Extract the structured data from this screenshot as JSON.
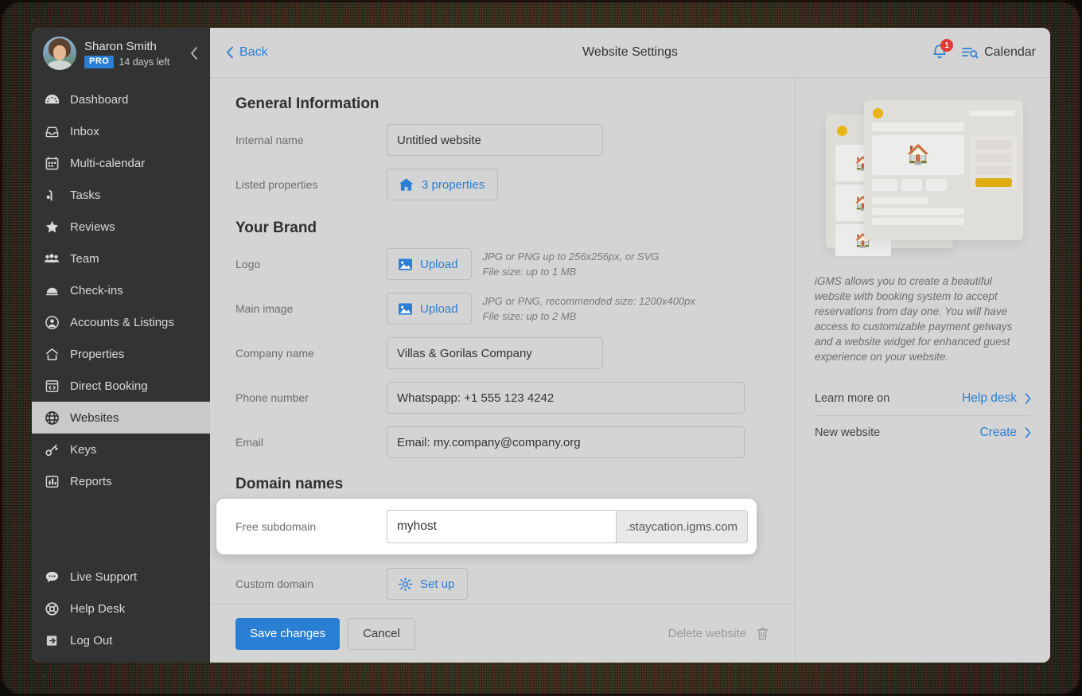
{
  "sidebar": {
    "user": {
      "name": "Sharon Smith",
      "plan_badge": "PRO",
      "trial": "14 days left"
    },
    "items": [
      {
        "label": "Dashboard",
        "icon": "dashboard-icon"
      },
      {
        "label": "Inbox",
        "icon": "inbox-icon"
      },
      {
        "label": "Multi-calendar",
        "icon": "calendar-icon"
      },
      {
        "label": "Tasks",
        "icon": "tasks-icon"
      },
      {
        "label": "Reviews",
        "icon": "star-icon"
      },
      {
        "label": "Team",
        "icon": "team-icon"
      },
      {
        "label": "Check-ins",
        "icon": "bell-service-icon"
      },
      {
        "label": "Accounts & Listings",
        "icon": "account-circle-icon"
      },
      {
        "label": "Properties",
        "icon": "home-icon"
      },
      {
        "label": "Direct Booking",
        "icon": "code-window-icon"
      },
      {
        "label": "Websites",
        "icon": "globe-icon",
        "active": true
      },
      {
        "label": "Keys",
        "icon": "key-icon"
      },
      {
        "label": "Reports",
        "icon": "bar-chart-icon"
      }
    ],
    "bottom_items": [
      {
        "label": "Live Support",
        "icon": "chat-bubble-icon"
      },
      {
        "label": "Help Desk",
        "icon": "lifebuoy-icon"
      },
      {
        "label": "Log Out",
        "icon": "logout-icon"
      }
    ]
  },
  "topbar": {
    "back_label": "Back",
    "title": "Website Settings",
    "notification_count": "1",
    "calendar_label": "Calendar"
  },
  "form": {
    "sections": {
      "general": "General Information",
      "brand": "Your Brand",
      "domains": "Domain names"
    },
    "internal_name": {
      "label": "Internal name",
      "value": "Untitled website"
    },
    "listed_properties": {
      "label": "Listed properties",
      "button": "3 properties"
    },
    "logo": {
      "label": "Logo",
      "button": "Upload",
      "hint_line1": "JPG or PNG up to 256x256px, or SVG",
      "hint_line2": "File size: up to 1 MB"
    },
    "main_image": {
      "label": "Main image",
      "button": "Upload",
      "hint_line1": "JPG or PNG, recommended size: 1200x400px",
      "hint_line2": "File size: up to 2 MB"
    },
    "company_name": {
      "label": "Company name",
      "value": "Villas & Gorilas Company"
    },
    "phone_number": {
      "label": "Phone number",
      "value": "Whatspapp: +1 555 123 4242"
    },
    "email": {
      "label": "Email",
      "value": "Email: my.company@company.org"
    },
    "free_subdomain": {
      "label": "Free subdomain",
      "value": "myhost",
      "suffix": ".staycation.igms.com"
    },
    "custom_domain": {
      "label": "Custom domain",
      "button": "Set up"
    }
  },
  "footer": {
    "save_label": "Save changes",
    "cancel_label": "Cancel",
    "delete_label": "Delete website"
  },
  "info_panel": {
    "description": "iGMS allows you to create a beautiful website with booking system to accept reservations from day one. You will have access to customizable payment getways and a website widget for enhanced guest experience on your website.",
    "rows": [
      {
        "label": "Learn more on",
        "link": "Help desk"
      },
      {
        "label": "New website",
        "link": "Create"
      }
    ]
  },
  "colors": {
    "accent_blue": "#2a7fd4",
    "sidebar_bg": "#333333",
    "page_bg": "#d4d4d4",
    "badge_red": "#e23c34",
    "illustration_yellow": "#e0ad10"
  }
}
